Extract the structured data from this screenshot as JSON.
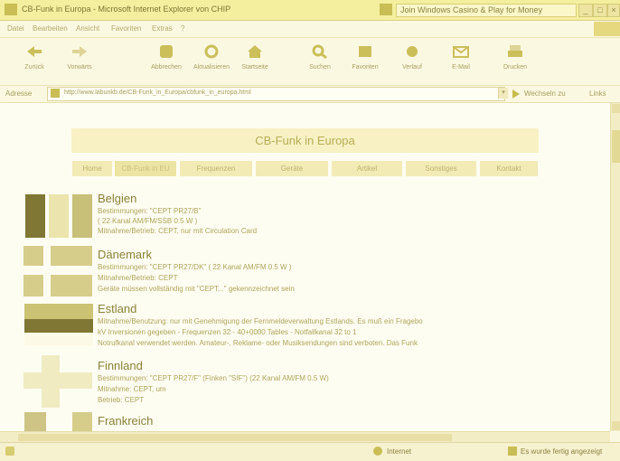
{
  "window": {
    "title": "CB-Funk in Europa - Microsoft Internet Explorer von CHIP",
    "taskbar_item": "Join Windows Casino & Play for Money",
    "controls": [
      "_",
      "□",
      "×"
    ]
  },
  "menu": [
    "Datei",
    "Bearbeiten",
    "Ansicht",
    "Favoriten",
    "Extras",
    "?"
  ],
  "toolbar": [
    {
      "label": "Zurück",
      "icon": "back-icon"
    },
    {
      "label": "Vorwärts",
      "icon": "forward-icon"
    },
    {
      "label": "Abbrechen",
      "icon": "stop-icon"
    },
    {
      "label": "Aktualisieren",
      "icon": "refresh-icon"
    },
    {
      "label": "Startseite",
      "icon": "home-icon"
    },
    {
      "label": "Suchen",
      "icon": "search-icon"
    },
    {
      "label": "Favoriten",
      "icon": "favorites-icon"
    },
    {
      "label": "Verlauf",
      "icon": "history-icon"
    },
    {
      "label": "E-Mail",
      "icon": "mail-icon"
    },
    {
      "label": "Drucken",
      "icon": "print-icon"
    }
  ],
  "address": {
    "label": "Adresse",
    "value": "http://www.labunkb.de/CB-Funk_in_Europa/cbfunk_in_europa.html",
    "go_label": "Wechseln zu",
    "links_label": "Links"
  },
  "site": {
    "title": "CB-Funk in Europa",
    "nav": [
      "Home",
      "CB-Funk in EU",
      "Frequenzen",
      "Geräte",
      "Artikel",
      "Sonstiges",
      "Kontakt"
    ],
    "countries": [
      {
        "name": "Belgien",
        "lines": [
          "Bestimmungen: \"CEPT PR27/B\"",
          "( 22 Kanal AM/FM/SSB 0.5 W )",
          "Mitnahme/Betrieb: CEPT, nur mit Circulation Card"
        ]
      },
      {
        "name": "Dänemark",
        "lines": [
          "Bestimmungen: \"CEPT PR27/DK\" ( 22 Kanal AM/FM 0.5 W )",
          "Mitnahme/Betrieb: CEPT",
          "Geräte müssen vollständig mit \"CEPT...\" gekennzeichnet sein"
        ]
      },
      {
        "name": "Estland",
        "lines": [
          "Mitnahme/Benutzung: nur mit Genehmigung der Fernmeldeverwaltung Estlands. Es muß ein Fragebo",
          "kV Inversionen gegeben - Frequenzen 32 - 40+0000 Tables - Notfallkanal 32 to 1",
          "Notrufkanal verwendet werden. Amateur-, Reklame- oder Musiksendungen sind verboten. Das Funk"
        ]
      },
      {
        "name": "Finnland",
        "lines": [
          "Bestimmungen: \"CEPT PR27/F\" (Finken \"SIF\") (22 Kanal AM/FM 0.5 W)",
          "Mitnahme: CEPT, um",
          "Betrieb: CEPT"
        ]
      },
      {
        "name": "Frankreich",
        "lines": []
      }
    ]
  },
  "status": {
    "zone": "Internet",
    "right": "Es wurde fertig angezeigt"
  }
}
